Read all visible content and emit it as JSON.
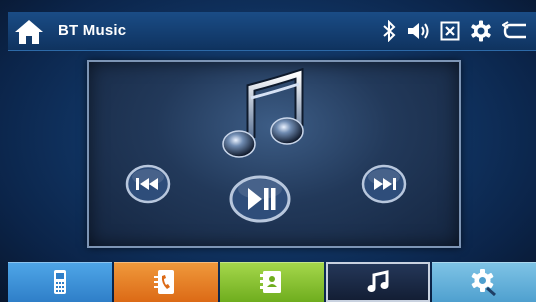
{
  "header": {
    "title": "BT Music",
    "icons": [
      "home-icon",
      "bluetooth-icon",
      "volume-icon",
      "close-box-icon",
      "settings-gear-icon",
      "back-icon"
    ]
  },
  "player": {
    "album_art_icon": "music-note-icon",
    "controls": [
      "previous-track-icon",
      "play-pause-icon",
      "next-track-icon"
    ]
  },
  "dock": {
    "items": [
      {
        "name": "phone",
        "icon": "phone-icon",
        "color": "#3b8fd6"
      },
      {
        "name": "call-log",
        "icon": "call-log-icon",
        "color": "#e57a22"
      },
      {
        "name": "contacts",
        "icon": "contacts-icon",
        "color": "#8cc437"
      },
      {
        "name": "music",
        "icon": "music-note-icon",
        "color": "#1a2a47",
        "active": true
      },
      {
        "name": "settings",
        "icon": "settings-gear-icon",
        "color": "#63b2dc"
      }
    ]
  },
  "colors": {
    "background": "#123a6c",
    "topbar": "#1a4c86",
    "accent": "#ffffff"
  }
}
